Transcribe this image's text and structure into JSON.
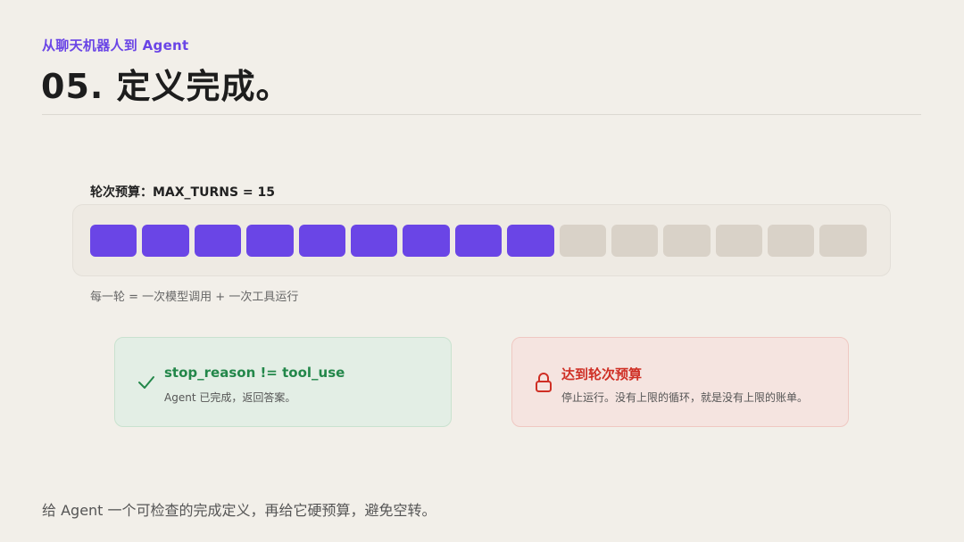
{
  "header": {
    "kicker": "从聊天机器人到 Agent",
    "title": "05. 定义完成。"
  },
  "budget": {
    "label": "轮次预算：MAX_TURNS = 15",
    "max_turns": 15,
    "used_turns": 9,
    "note": "每一轮 = 一次模型调用 + 一次工具运行"
  },
  "cards": {
    "success": {
      "icon": "check-icon",
      "title": "stop_reason != tool_use",
      "desc": "Agent 已完成，返回答案。"
    },
    "limit": {
      "icon": "lock-icon",
      "title": "达到轮次预算",
      "desc": "停止运行。没有上限的循环，就是没有上限的账单。"
    }
  },
  "footer": {
    "text": "给 Agent 一个可检查的完成定义，再给它硬预算，避免空转。"
  },
  "colors": {
    "accent": "#6a45e6",
    "unused": "#d9d2c8",
    "success": "#23874a",
    "danger": "#cf2f25"
  }
}
